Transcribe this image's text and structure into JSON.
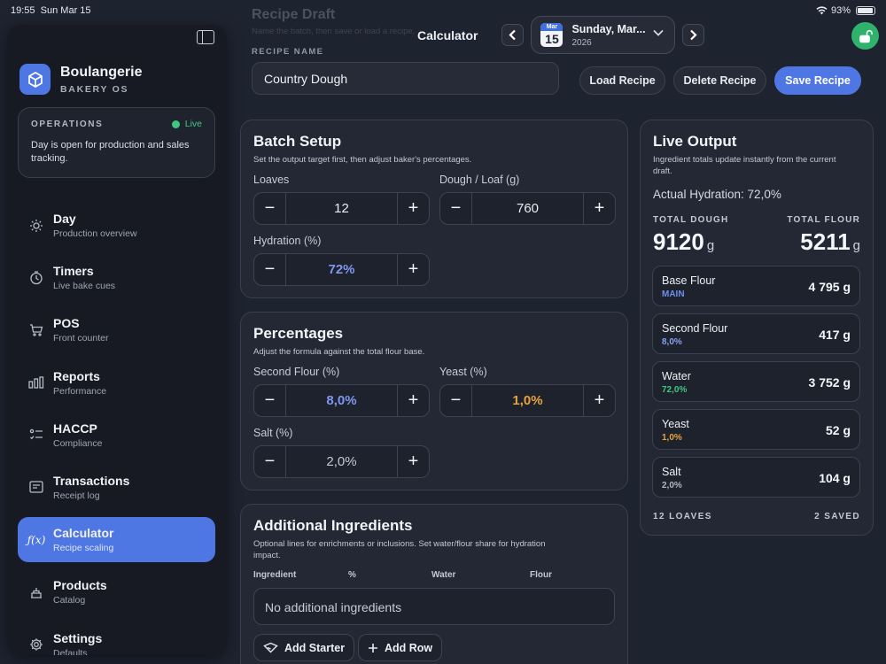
{
  "status_bar": {
    "time": "19:55",
    "date": "Sun Mar 15",
    "battery": "93%"
  },
  "sidebar": {
    "brand": {
      "name": "Boulangerie",
      "subtitle": "BAKERY OS"
    },
    "operations": {
      "title": "OPERATIONS",
      "status": "Live",
      "message": "Day is open for production and sales tracking."
    },
    "items": [
      {
        "label": "Day",
        "sub": "Production overview",
        "icon": "sun-icon"
      },
      {
        "label": "Timers",
        "sub": "Live bake cues",
        "icon": "timer-icon"
      },
      {
        "label": "POS",
        "sub": "Front counter",
        "icon": "cart-icon"
      },
      {
        "label": "Reports",
        "sub": "Performance",
        "icon": "bar-chart-icon"
      },
      {
        "label": "HACCP",
        "sub": "Compliance",
        "icon": "checklist-icon"
      },
      {
        "label": "Transactions",
        "sub": "Receipt log",
        "icon": "receipt-icon"
      },
      {
        "label": "Calculator",
        "sub": "Recipe scaling",
        "icon": "function-icon",
        "active": true
      },
      {
        "label": "Products",
        "sub": "Catalog",
        "icon": "cake-icon"
      },
      {
        "label": "Settings",
        "sub": "Defaults",
        "icon": "gear-icon"
      }
    ]
  },
  "header": {
    "title": "Calculator",
    "date_label": "Sunday, Mar...",
    "year": "2026",
    "calendar_month": "Mar",
    "calendar_day": "15",
    "draft_title": "Recipe Draft",
    "draft_sub": "Name the batch, then save or load a recipe."
  },
  "recipe": {
    "label": "RECIPE NAME",
    "name": "Country Dough",
    "load_label": "Load Recipe",
    "delete_label": "Delete Recipe",
    "save_label": "Save Recipe"
  },
  "batch": {
    "title": "Batch Setup",
    "subtitle": "Set the output target first, then adjust baker's percentages.",
    "loaves_label": "Loaves",
    "loaves": "12",
    "dough_label": "Dough / Loaf (g)",
    "dough": "760",
    "hydration_label": "Hydration (%)",
    "hydration": "72%"
  },
  "percentages": {
    "title": "Percentages",
    "subtitle": "Adjust the formula against the total flour base.",
    "second_flour_label": "Second Flour (%)",
    "second_flour": "8,0%",
    "yeast_label": "Yeast (%)",
    "yeast": "1,0%",
    "salt_label": "Salt (%)",
    "salt": "2,0%"
  },
  "additional": {
    "title": "Additional Ingredients",
    "subtitle": "Optional lines for enrichments or inclusions. Set water/flour share for hydration impact.",
    "columns": [
      "Ingredient",
      "%",
      "Water",
      "Flour"
    ],
    "empty": "No additional ingredients",
    "add_starter": "Add Starter",
    "add_row": "Add Row"
  },
  "output": {
    "title": "Live Output",
    "subtitle": "Ingredient totals update instantly from the current draft.",
    "hydration": "Actual Hydration: 72,0%",
    "total_dough_label": "TOTAL DOUGH",
    "total_dough": "9120",
    "total_dough_unit": "g",
    "total_flour_label": "TOTAL FLOUR",
    "total_flour": "5211",
    "total_flour_unit": "g",
    "ingredients": [
      {
        "name": "Base Flour",
        "pct": "MAIN",
        "value": "4 795 g",
        "color": "#6f8ef0"
      },
      {
        "name": "Second Flour",
        "pct": "8,0%",
        "value": "417 g",
        "color": "#8aa0f2"
      },
      {
        "name": "Water",
        "pct": "72,0%",
        "value": "3 752 g",
        "color": "#3ec682"
      },
      {
        "name": "Yeast",
        "pct": "1,0%",
        "value": "52 g",
        "color": "#e8a23d"
      },
      {
        "name": "Salt",
        "pct": "2,0%",
        "value": "104 g",
        "color": "#b0b6c2"
      }
    ],
    "loaves_count": "12 LOAVES",
    "saved_count": "2 SAVED"
  },
  "colors": {
    "accent": "#4f77e3",
    "live": "#3ec682",
    "yeast": "#e8a23d"
  }
}
